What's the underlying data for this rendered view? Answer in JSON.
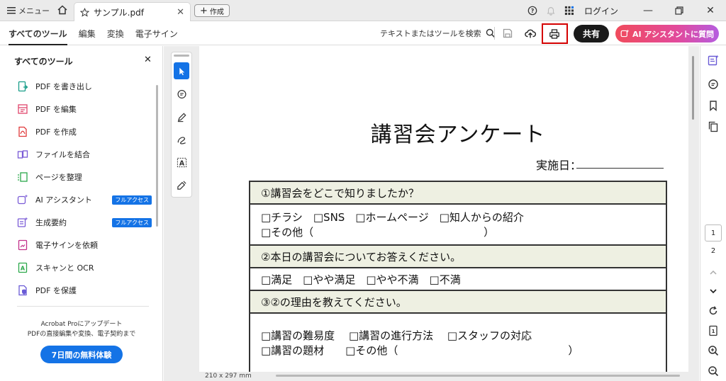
{
  "titlebar": {
    "menu_label": "メニュー",
    "tab_title": "サンプル.pdf",
    "new_label": "作成",
    "login_label": "ログイン"
  },
  "toolbar": {
    "nav": [
      "すべてのツール",
      "編集",
      "変換",
      "電子サイン"
    ],
    "search_label": "テキストまたはツールを検索",
    "share_label": "共有",
    "ai_label": "AI アシスタントに質問"
  },
  "panel": {
    "title": "すべてのツール",
    "tools": [
      {
        "label": "PDF を書き出し",
        "icon": "export-pdf-icon",
        "color": "#1a9e8a"
      },
      {
        "label": "PDF を編集",
        "icon": "edit-pdf-icon",
        "color": "#e0466c"
      },
      {
        "label": "PDF を作成",
        "icon": "create-pdf-icon",
        "color": "#e0383a"
      },
      {
        "label": "ファイルを結合",
        "icon": "combine-files-icon",
        "color": "#7a5bd6"
      },
      {
        "label": "ページを整理",
        "icon": "organize-pages-icon",
        "color": "#2ba84a"
      },
      {
        "label": "AI アシスタント",
        "icon": "ai-assistant-icon",
        "color": "#7a5bd6",
        "badge": "フルアクセス"
      },
      {
        "label": "生成要約",
        "icon": "summary-icon",
        "color": "#7a5bd6",
        "badge": "フルアクセス"
      },
      {
        "label": "電子サインを依頼",
        "icon": "request-esign-icon",
        "color": "#c2308a"
      },
      {
        "label": "スキャンと OCR",
        "icon": "scan-ocr-icon",
        "color": "#2ba84a"
      },
      {
        "label": "PDF を保護",
        "icon": "protect-pdf-icon",
        "color": "#6a5bd6"
      }
    ],
    "promo_line1": "Acrobat Proにアップデート",
    "promo_line2": "PDFの直接編集や変換、電子契約まで",
    "trial_label": "7日間の無料体験"
  },
  "document": {
    "title": "講習会アンケート",
    "date_label": "実施日：",
    "q1": "①講習会をどこで知りましたか？",
    "q1_line1": "□チラシ　□SNS　□ホームページ　□知人からの紹介",
    "q1_line2": "□その他（　　　　　　　　　　　　　　　　）",
    "q2": "②本日の講習会についてお答えください。",
    "q2_line1": "□満足　□やや満足　□やや不満　□不満",
    "q3": "③②の理由を教えてください。",
    "q3_line1": "□講習の難易度　 □講習の進行方法　 □スタッフの対応",
    "q3_line2": "□講習の題材　　□その他（　　　　　　　　　　　　　　　　）"
  },
  "status": {
    "page_size": "210 x 297 mm"
  },
  "pages": {
    "current": "1",
    "next": "2"
  },
  "colors": {
    "accent": "#1473e6",
    "highlight_box": "#d40000",
    "question_bg": "#eef0e2"
  }
}
